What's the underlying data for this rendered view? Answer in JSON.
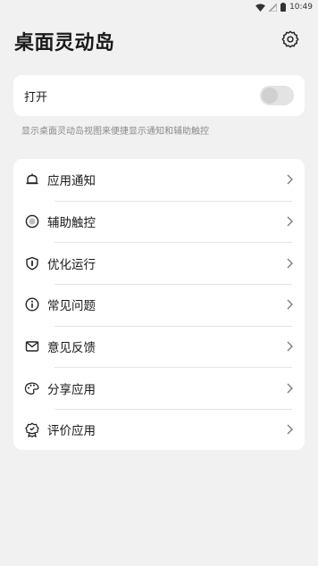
{
  "status_bar": {
    "time": "10:49"
  },
  "header": {
    "title": "桌面灵动岛"
  },
  "toggle": {
    "label": "打开",
    "enabled": false
  },
  "description": "显示桌面灵动岛视图来便捷显示通知和辅助触控",
  "menu": {
    "items": [
      {
        "label": "应用通知",
        "icon": "bell-icon"
      },
      {
        "label": "辅助触控",
        "icon": "assistive-touch-icon"
      },
      {
        "label": "优化运行",
        "icon": "shield-icon"
      },
      {
        "label": "常见问题",
        "icon": "info-icon"
      },
      {
        "label": "意见反馈",
        "icon": "mail-icon"
      },
      {
        "label": "分享应用",
        "icon": "share-icon"
      },
      {
        "label": "评价应用",
        "icon": "rate-badge-icon"
      }
    ]
  },
  "colors": {
    "background": "#f1f1f1",
    "card": "#ffffff",
    "text": "#1a1a1a",
    "muted": "#8a8a8a"
  }
}
